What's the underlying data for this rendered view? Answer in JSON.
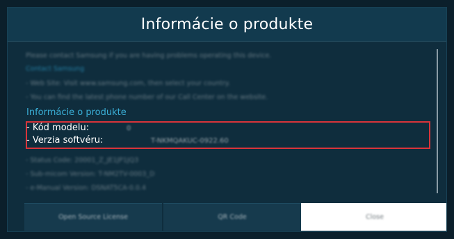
{
  "dialog": {
    "title": "Informácie o produkte",
    "blurred_lines_top": [
      "Please contact Samsung if you are having problems operating this device.",
      "Contact Samsung",
      "- Web Site: Visit www.samsung.com, then select your country.",
      "- You can find the latest phone number of our Call Center on the website."
    ],
    "section_title": "Informácie o produkte",
    "model_label": "- Kód modelu:",
    "model_value": "0",
    "software_label": "- Verzia softvéru:",
    "software_value": "T-NKMQAKUC-0922.60",
    "blurred_lines_bottom": [
      "- Status Code: 20001_Z_JE1JP1JQ3",
      "- Sub-micom Version: T-NM2TV-0003_D",
      "- e-Manual Version: DSNAT5CA-0.0.4"
    ],
    "buttons": {
      "open_source": "Open Source License",
      "qr_code": "QR Code",
      "close": "Close"
    }
  },
  "colors": {
    "accent": "#3aaed6",
    "highlight": "#d9343a",
    "background": "#0f2d3d"
  }
}
